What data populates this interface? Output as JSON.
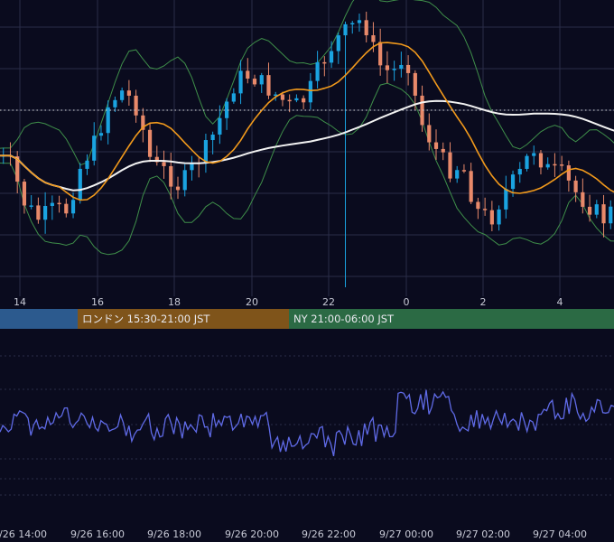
{
  "chart_data": [
    {
      "type": "candlestick",
      "panel": "price",
      "x_ticks": [
        "14",
        "16",
        "18",
        "20",
        "22",
        "0",
        "2",
        "4"
      ],
      "candle_interval_minutes": 10,
      "candle_count": 90,
      "bar_anchor_hours": [
        14.2,
        14.9,
        15.3,
        16.2,
        16.7,
        17.4,
        17.8,
        18.2,
        18.7,
        19.3,
        19.8,
        20.4,
        20.9,
        21.4,
        21.9,
        22.3,
        22.8,
        23.3,
        0.0,
        0.3,
        0.6,
        1.1,
        1.4,
        1.8,
        2.2,
        2.6,
        3.1,
        3.4,
        3.6,
        3.9,
        4.2,
        4.6,
        5.0,
        5.3
      ],
      "price_anchor_levels": [
        0.64,
        0.6,
        0.43,
        0.36,
        0.4,
        0.4,
        0.6,
        0.7,
        0.88,
        0.93,
        0.85,
        0.6,
        0.57,
        0.5,
        0.6,
        0.68,
        0.83,
        0.98,
        1.0,
        0.95,
        0.9,
        0.85,
        0.9,
        1.05,
        1.15,
        1.2,
        1.25,
        1.05,
        1.0,
        1.1,
        0.8,
        0.68,
        0.58,
        0.6,
        0.4,
        0.36,
        0.48,
        0.55,
        0.68,
        0.58,
        0.56,
        0.48,
        0.42,
        0.36,
        0.43
      ],
      "price_axis": "unlabeled (relative)",
      "overlays": [
        {
          "name": "",
          "kind": "moving_average_short",
          "color": "#f29a1c"
        },
        {
          "name": "",
          "kind": "moving_average_long",
          "color": "#f2f2f2"
        },
        {
          "name": "",
          "kind": "bollinger_bands",
          "color": "#3f8f4a"
        }
      ],
      "reference_line": {
        "style": "dotted",
        "color": "#dcdcdc"
      },
      "colors": {
        "up": "#1aa3e0",
        "down": "#e8896a",
        "grid": "#2a2d48"
      }
    },
    {
      "type": "line",
      "panel": "oscillator",
      "series": [
        {
          "name": "",
          "color": "#5f6ae6"
        }
      ],
      "x_ticks": [
        "9/26 14:00",
        "9/26 16:00",
        "9/26 18:00",
        "9/26 20:00",
        "9/26 22:00",
        "9/27 00:00",
        "9/27 02:00",
        "9/27 04:00"
      ],
      "y_axis": "unlabeled (relative)",
      "grid": "dashed horizontal"
    }
  ],
  "sessions": [
    {
      "label": "",
      "color": "#2c5a8e"
    },
    {
      "label": "ロンドン 15:30-21:00 JST",
      "color": "#7f541a"
    },
    {
      "label": "NY 21:00-06:00 JST",
      "color": "#2b6a44"
    }
  ]
}
